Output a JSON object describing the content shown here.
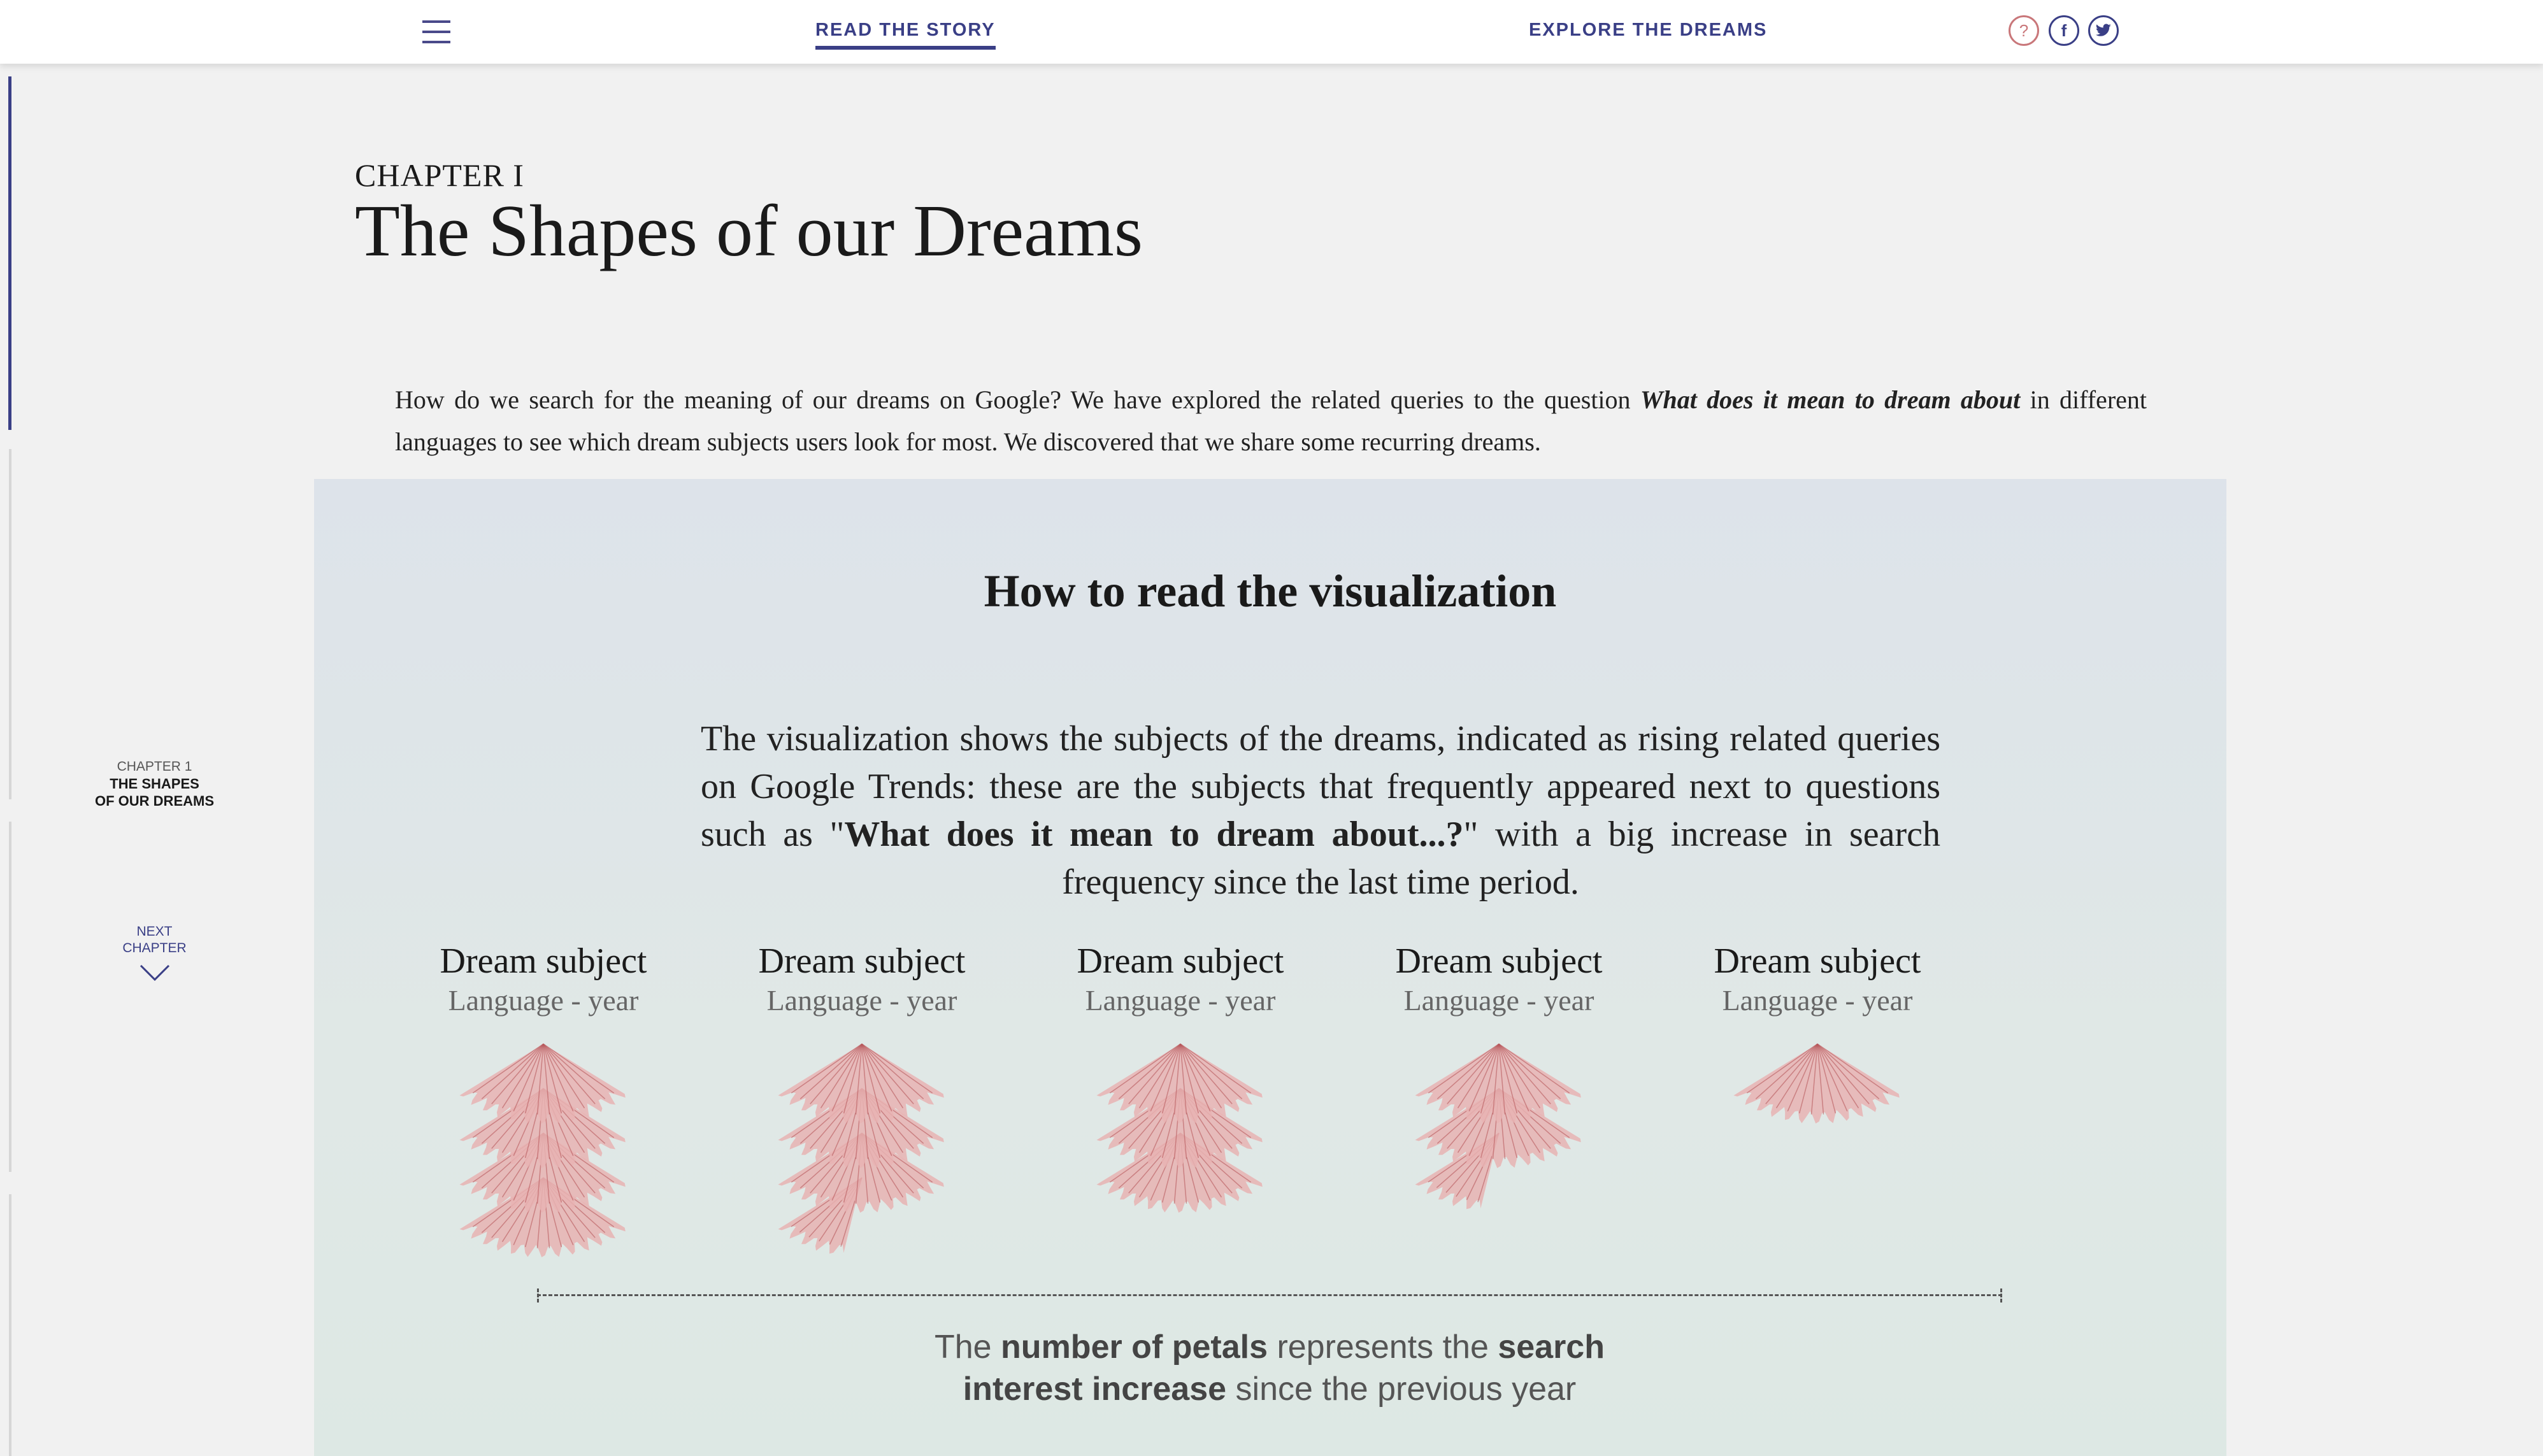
{
  "nav": {
    "menu_icon": "hamburger-icon",
    "read_story": "READ THE STORY",
    "explore_dreams": "EXPLORE THE DREAMS",
    "help_icon": "?",
    "facebook_icon": "f",
    "twitter_icon": "twitter-bird"
  },
  "sidebar": {
    "chapter_small": "CHAPTER 1",
    "chapter_name_1": "THE SHAPES",
    "chapter_name_2": "OF OUR DREAMS",
    "next_1": "NEXT",
    "next_2": "CHAPTER"
  },
  "header": {
    "chapter_label": "CHAPTER I",
    "title": "The Shapes of our Dreams"
  },
  "intro": {
    "part1": "How do we search for the meaning of our dreams on Google? We have explored the related queries to the question ",
    "emphasis": "What does it mean to dream about",
    "part2": " in different languages to see which dream subjects users look for most. We discovered that we share some recurring dreams."
  },
  "viz": {
    "title": "How to read the visualization",
    "desc_part1": "The visualization shows the subjects of the dreams, indicated as rising related queries on Google Trends: these are the subjects that frequently appeared next to questions such as \"",
    "desc_bold": "What does it mean to dream about...?",
    "desc_part2": "\" with a big increase in search frequency since the last time period.",
    "flowers": [
      {
        "subject": "Dream subject",
        "language": "Language - year",
        "petal_rows": 4
      },
      {
        "subject": "Dream subject",
        "language": "Language - year",
        "petal_rows": 3.5
      },
      {
        "subject": "Dream subject",
        "language": "Language - year",
        "petal_rows": 3
      },
      {
        "subject": "Dream subject",
        "language": "Language - year",
        "petal_rows": 2.5
      },
      {
        "subject": "Dream subject",
        "language": "Language - year",
        "petal_rows": 1
      }
    ],
    "legend_pre": "The ",
    "legend_b1": "number of petals",
    "legend_mid": " represents the ",
    "legend_b2": "search interest increase",
    "legend_post": " since the previous year"
  },
  "colors": {
    "accent": "#3a3f86",
    "petal": "#e8b3b3",
    "petal_vein": "#b7585c"
  }
}
